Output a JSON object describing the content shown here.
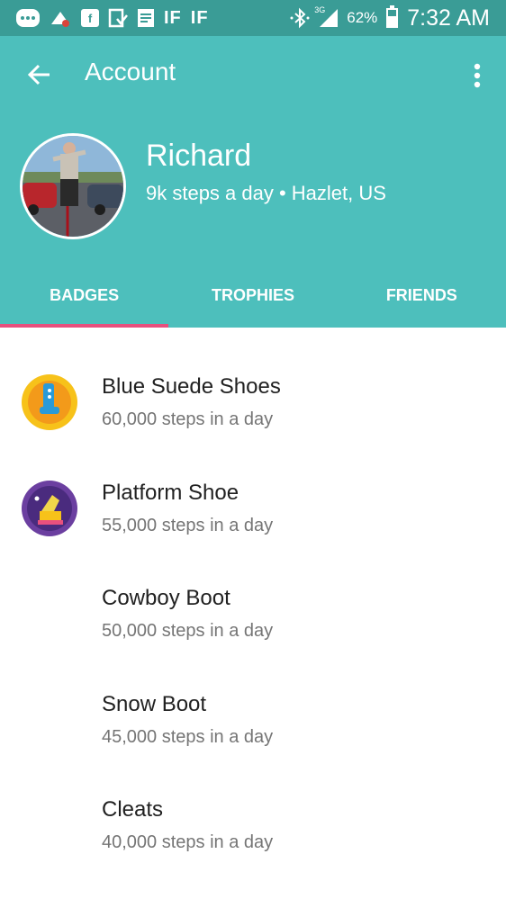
{
  "status_bar": {
    "battery_percent": "62%",
    "battery_level": 0.62,
    "time": "7:32 AM",
    "network": "3G",
    "icons": [
      "message-icon",
      "sync-icon",
      "facebook-icon",
      "download-icon",
      "document-icon",
      "ifttt-icon",
      "ifttt-icon",
      "bluetooth-icon",
      "signal-icon",
      "battery-icon"
    ]
  },
  "app_bar": {
    "title": "Account",
    "back_icon": "arrow-back-icon",
    "menu_icon": "more-vert-icon"
  },
  "profile": {
    "name": "Richard",
    "description": "9k steps a day • Hazlet, US"
  },
  "tabs": [
    {
      "label": "BADGES",
      "active": true
    },
    {
      "label": "TROPHIES",
      "active": false
    },
    {
      "label": "FRIENDS",
      "active": false
    }
  ],
  "badges": [
    {
      "title": "Blue Suede Shoes",
      "subtitle": "60,000 steps in a day",
      "icon": "blue-suede-shoes-badge-icon"
    },
    {
      "title": "Platform Shoe",
      "subtitle": "55,000 steps in a day",
      "icon": "platform-shoe-badge-icon"
    },
    {
      "title": "Cowboy Boot",
      "subtitle": "50,000 steps in a day",
      "icon": ""
    },
    {
      "title": "Snow Boot",
      "subtitle": "45,000 steps in a day",
      "icon": ""
    },
    {
      "title": "Cleats",
      "subtitle": "40,000 steps in a day",
      "icon": ""
    }
  ],
  "colors": {
    "status_bar": "#3a9c96",
    "header": "#4dbfbc",
    "tab_indicator": "#e8507e",
    "title_text": "#212121",
    "subtitle_text": "#757575"
  }
}
